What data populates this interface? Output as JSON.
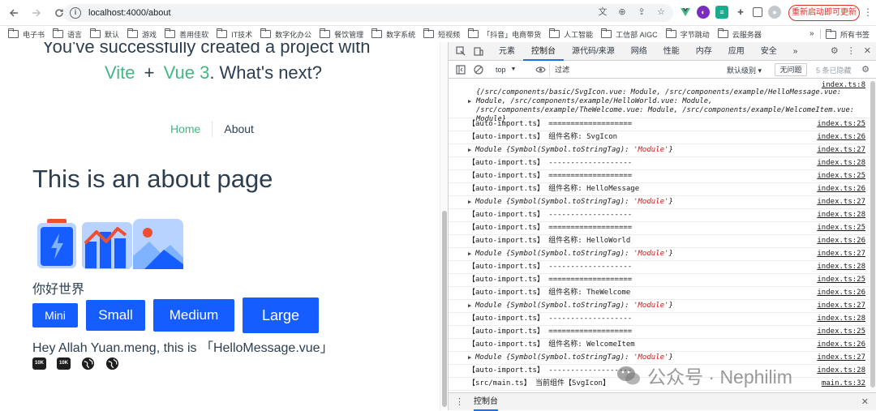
{
  "browser": {
    "url": "localhost:4000/about",
    "relaunch_label": "重新启动即可更新",
    "bookmarks": [
      "电子书",
      "语言",
      "默认",
      "游戏",
      "善用佳软",
      "IT技术",
      "数字化办公",
      "餐饮管理",
      "数字系统",
      "短视频",
      "「抖音」电商带货",
      "人工智能",
      "工信部 AIGC",
      "字节跳动",
      "云服务器"
    ],
    "bookmarks_more": "»",
    "bookmarks_all": "所有书签"
  },
  "page": {
    "cut_heading": "You've successfully created a project with",
    "next_line": {
      "vite": "Vite",
      "plus": "+",
      "vue": "Vue 3",
      "rest": ". What's next?"
    },
    "nav": {
      "home": "Home",
      "about": "About"
    },
    "about_title": "This is an about page",
    "hello_text": "你好世界",
    "buttons": {
      "mini": "Mini",
      "small": "Small",
      "medium": "Medium",
      "large": "Large"
    },
    "hey_text": "Hey Allah Yuan.meng, this is 「HelloMessage.vue」",
    "badge_10k": "10K"
  },
  "devtools": {
    "tabs": [
      "元素",
      "控制台",
      "源代码/来源",
      "网络",
      "性能",
      "内存",
      "应用",
      "安全"
    ],
    "active_tab": "控制台",
    "more_tabs": "»",
    "context": "top",
    "filter_placeholder": "过滤",
    "levels": "默认级别 ▾",
    "no_issues": "无问题",
    "hidden_count": "5 条已隐藏",
    "drawer_tab": "控制台",
    "object_row": {
      "text": "{/src/components/basic/SvgIcon.vue: Module, /src/components/example/HelloMessage.vue: Module, /src/components/example/HelloWorld.vue: Module, /src/components/example/TheWelcome.vue: Module, /src/components/example/WelcomeItem.vue: Module}",
      "src": "index.ts:8"
    },
    "rows": [
      {
        "type": "log",
        "msg": "【auto-import.ts】 ===================",
        "src": "index.ts:25"
      },
      {
        "type": "log",
        "msg": "【auto-import.ts】 组件名称: SvgIcon",
        "src": "index.ts:26"
      },
      {
        "type": "module",
        "pre": "Module {Symbol(Symbol.toStringTag): ",
        "str": "'Module'",
        "post": "}",
        "src": "index.ts:27"
      },
      {
        "type": "log",
        "msg": "【auto-import.ts】 -------------------",
        "src": "index.ts:28"
      },
      {
        "type": "log",
        "msg": "【auto-import.ts】 ===================",
        "src": "index.ts:25"
      },
      {
        "type": "log",
        "msg": "【auto-import.ts】 组件名称: HelloMessage",
        "src": "index.ts:26"
      },
      {
        "type": "module",
        "pre": "Module {Symbol(Symbol.toStringTag): ",
        "str": "'Module'",
        "post": "}",
        "src": "index.ts:27"
      },
      {
        "type": "log",
        "msg": "【auto-import.ts】 -------------------",
        "src": "index.ts:28"
      },
      {
        "type": "log",
        "msg": "【auto-import.ts】 ===================",
        "src": "index.ts:25"
      },
      {
        "type": "log",
        "msg": "【auto-import.ts】 组件名称: HelloWorld",
        "src": "index.ts:26"
      },
      {
        "type": "module",
        "pre": "Module {Symbol(Symbol.toStringTag): ",
        "str": "'Module'",
        "post": "}",
        "src": "index.ts:27"
      },
      {
        "type": "log",
        "msg": "【auto-import.ts】 -------------------",
        "src": "index.ts:28"
      },
      {
        "type": "log",
        "msg": "【auto-import.ts】 ===================",
        "src": "index.ts:25"
      },
      {
        "type": "log",
        "msg": "【auto-import.ts】 组件名称: TheWelcome",
        "src": "index.ts:26"
      },
      {
        "type": "module",
        "pre": "Module {Symbol(Symbol.toStringTag): ",
        "str": "'Module'",
        "post": "}",
        "src": "index.ts:27"
      },
      {
        "type": "log",
        "msg": "【auto-import.ts】 -------------------",
        "src": "index.ts:28"
      },
      {
        "type": "log",
        "msg": "【auto-import.ts】 ===================",
        "src": "index.ts:25"
      },
      {
        "type": "log",
        "msg": "【auto-import.ts】 组件名称: WelcomeItem",
        "src": "index.ts:26"
      },
      {
        "type": "module",
        "pre": "Module {Symbol(Symbol.toStringTag): ",
        "str": "'Module'",
        "post": "}",
        "src": "index.ts:27"
      },
      {
        "type": "log",
        "msg": "【auto-import.ts】 -------------------",
        "src": "index.ts:28"
      },
      {
        "type": "log",
        "msg": "【src/main.ts】 当前组件【SvgIcon】",
        "src": "main.ts:32"
      }
    ]
  },
  "watermark": "公众号 · Nephilim",
  "colors": {
    "vue_green": "#42b883",
    "arco_blue": "#165dff",
    "text": "#2c3e50",
    "devtools_accent": "#1a73e8"
  }
}
